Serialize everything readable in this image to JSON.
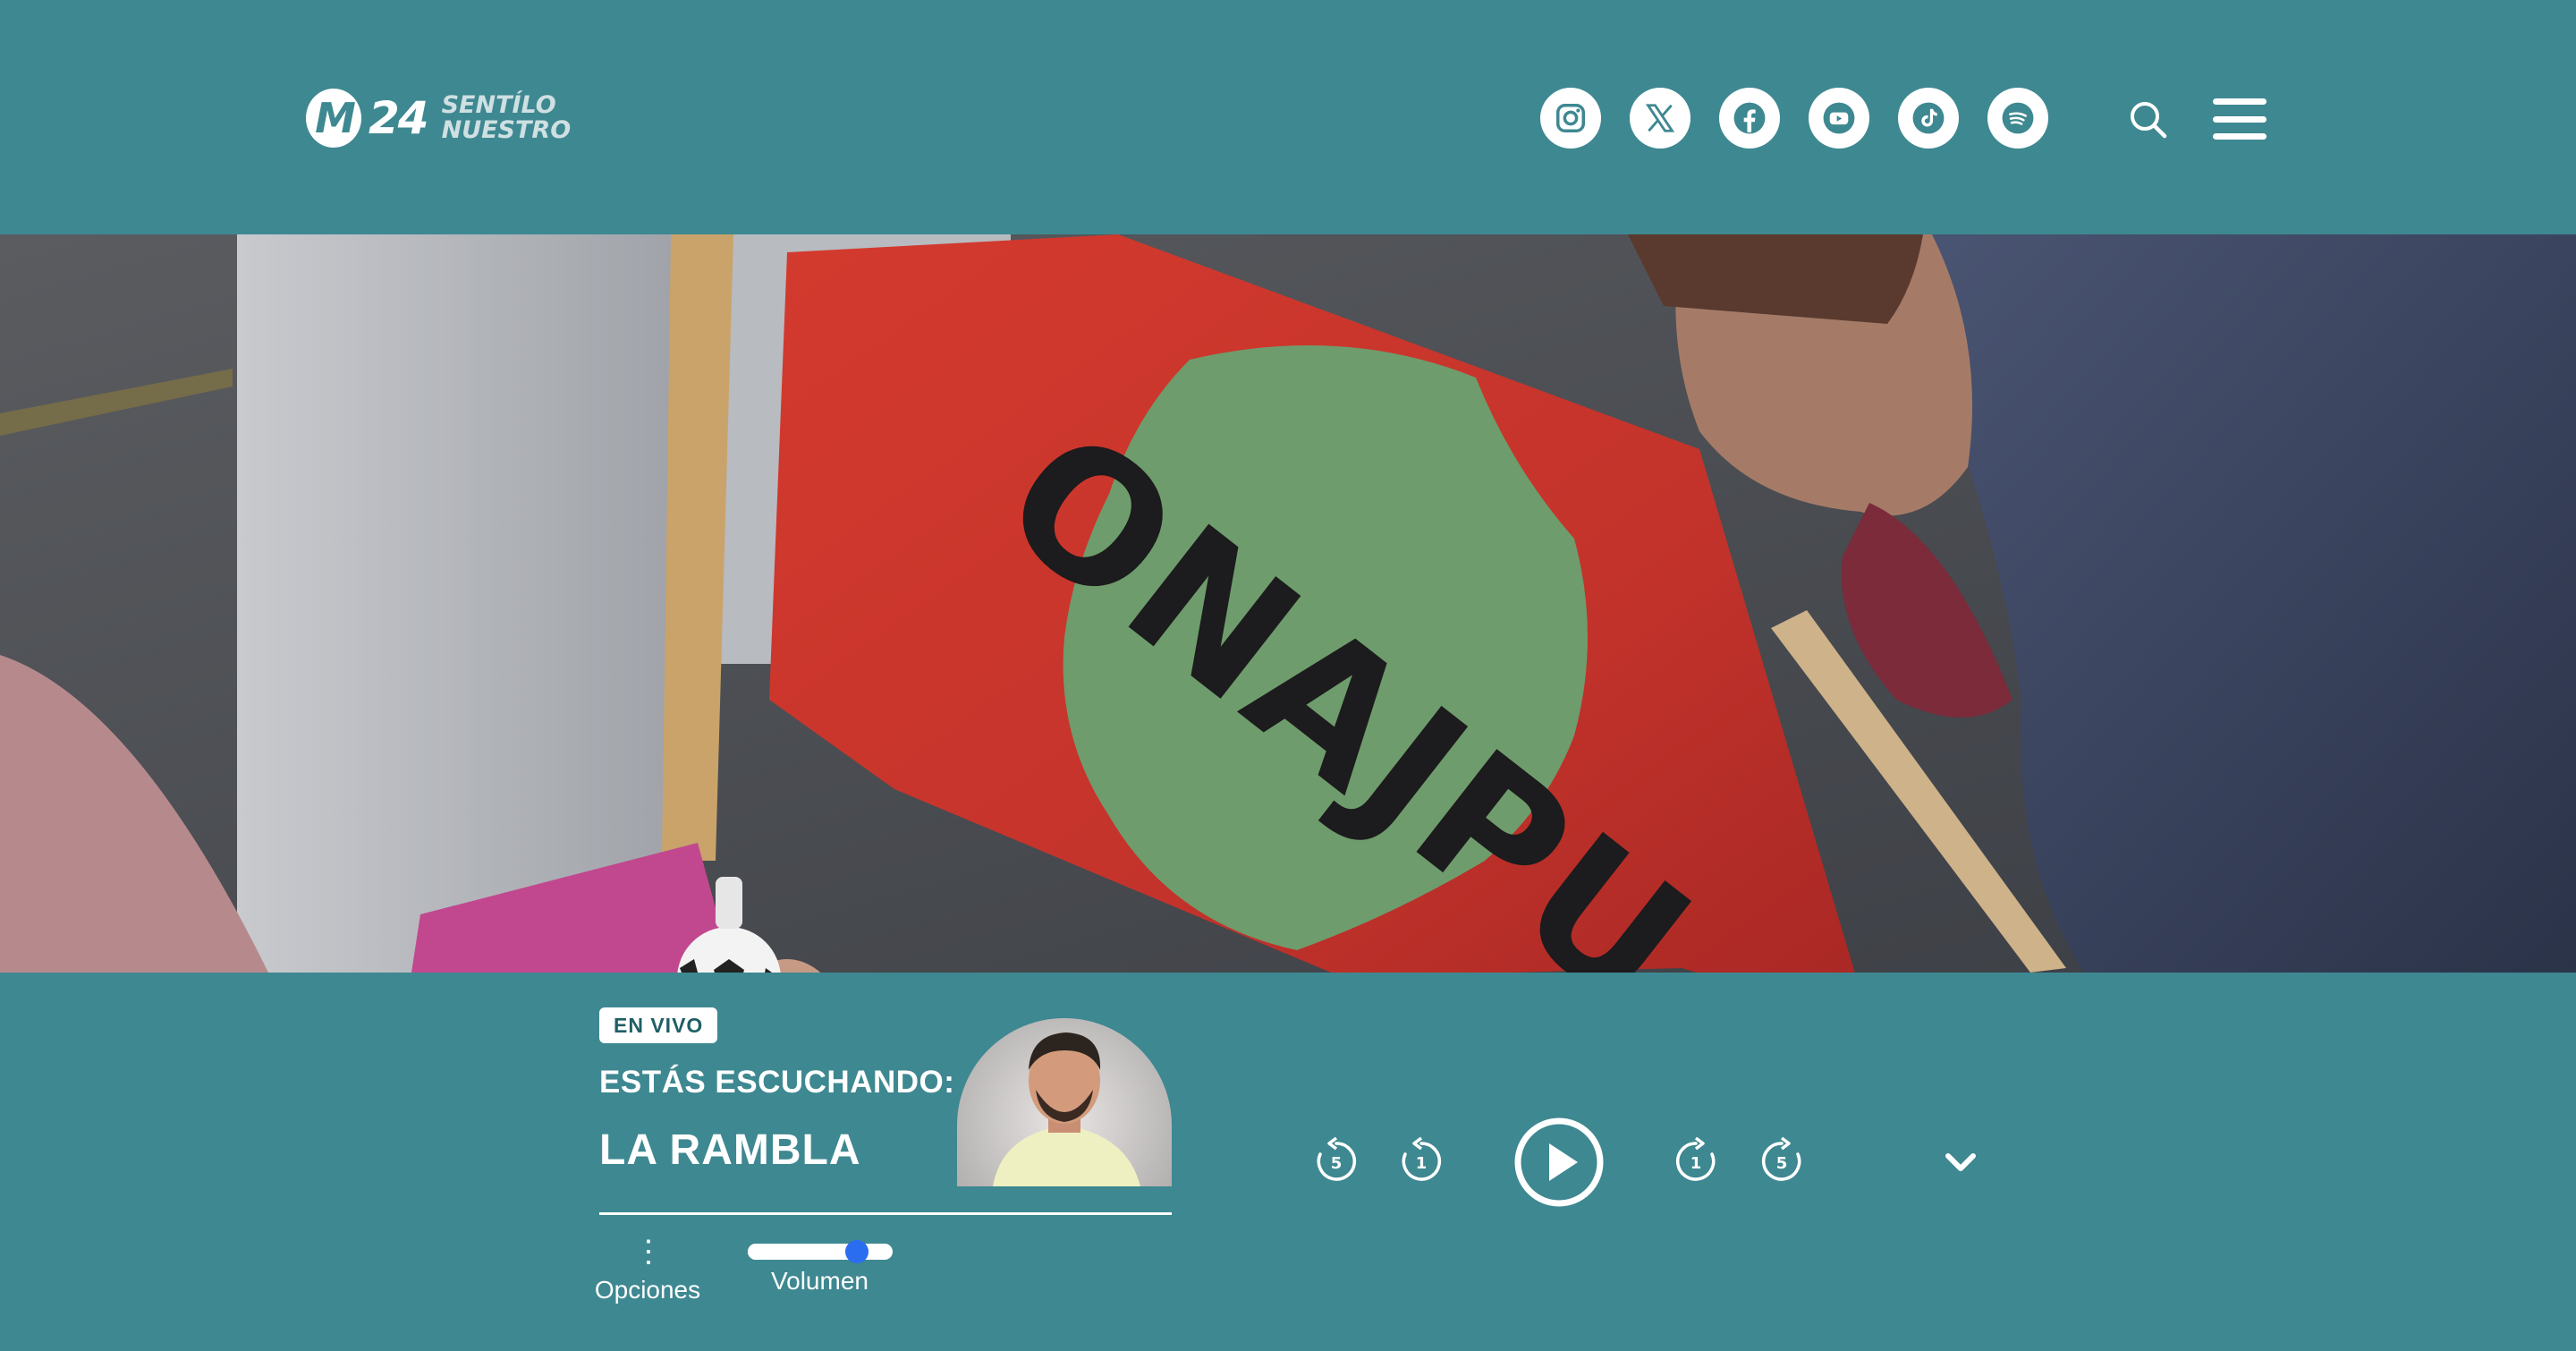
{
  "header": {
    "logo": {
      "mark": "M",
      "number": "24",
      "tagline_line1": "SENTÍLO",
      "tagline_line2": "NUESTRO"
    },
    "social_links": [
      {
        "name": "instagram-icon"
      },
      {
        "name": "x-icon"
      },
      {
        "name": "facebook-icon"
      },
      {
        "name": "youtube-icon"
      },
      {
        "name": "tiktok-icon"
      },
      {
        "name": "spotify-icon"
      }
    ],
    "search_icon": "search-icon",
    "menu_icon": "hamburger-menu-icon"
  },
  "hero": {
    "flag_text": "ONAJPU"
  },
  "player": {
    "live_badge": "EN VIVO",
    "listening_label": "ESTÁS ESCUCHANDO:",
    "program_name": "LA RAMBLA",
    "options_label": "Opciones",
    "volume_label": "Volumen",
    "volume_level": 0.75,
    "rewind_5_label": "5",
    "rewind_1_label": "1",
    "forward_1_label": "1",
    "forward_5_label": "5"
  },
  "colors": {
    "teal": "#3e8891",
    "white": "#ffffff",
    "volume_thumb": "#2b6df0"
  }
}
